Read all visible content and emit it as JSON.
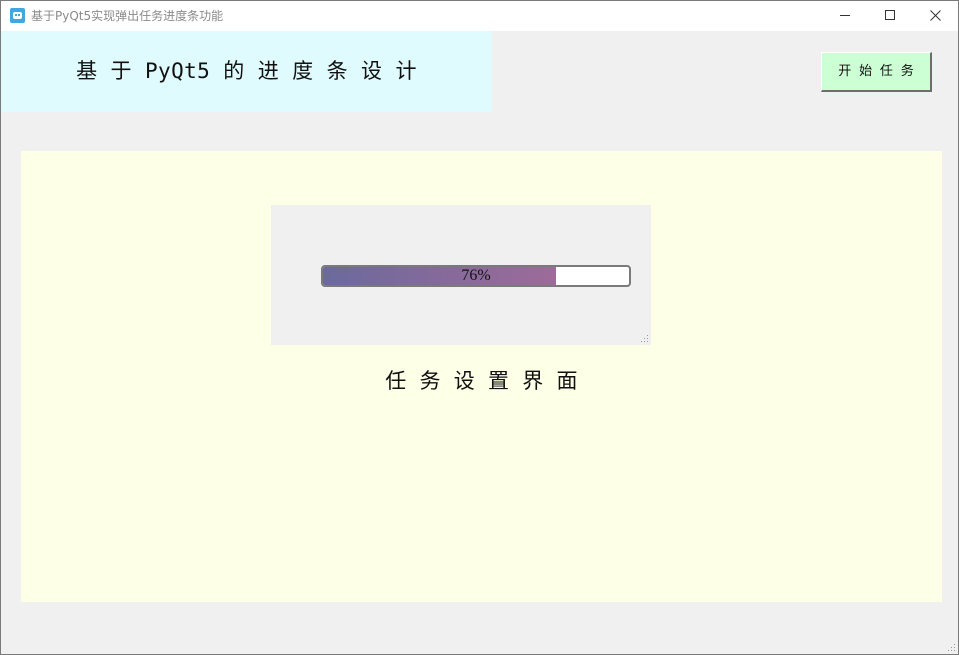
{
  "window": {
    "title": "基于PyQt5实现弹出任务进度条功能",
    "icon": "python-app-icon",
    "controls": [
      "minimize-icon",
      "maximize-icon",
      "close-icon"
    ]
  },
  "header": {
    "title": "基 于 PyQt5 的 进 度 条 设 计",
    "start_button_label": "开 始 任 务"
  },
  "progress_dialog": {
    "value": 76,
    "label": "76%"
  },
  "panel": {
    "caption": "任 务 设 置 界 面"
  },
  "colors": {
    "banner_bg": "#e0fbfe",
    "button_bg": "#ccffd4",
    "panel_bg": "#fdffe7",
    "progress_start": "#6b6a9c",
    "progress_end": "#9d6b99"
  }
}
